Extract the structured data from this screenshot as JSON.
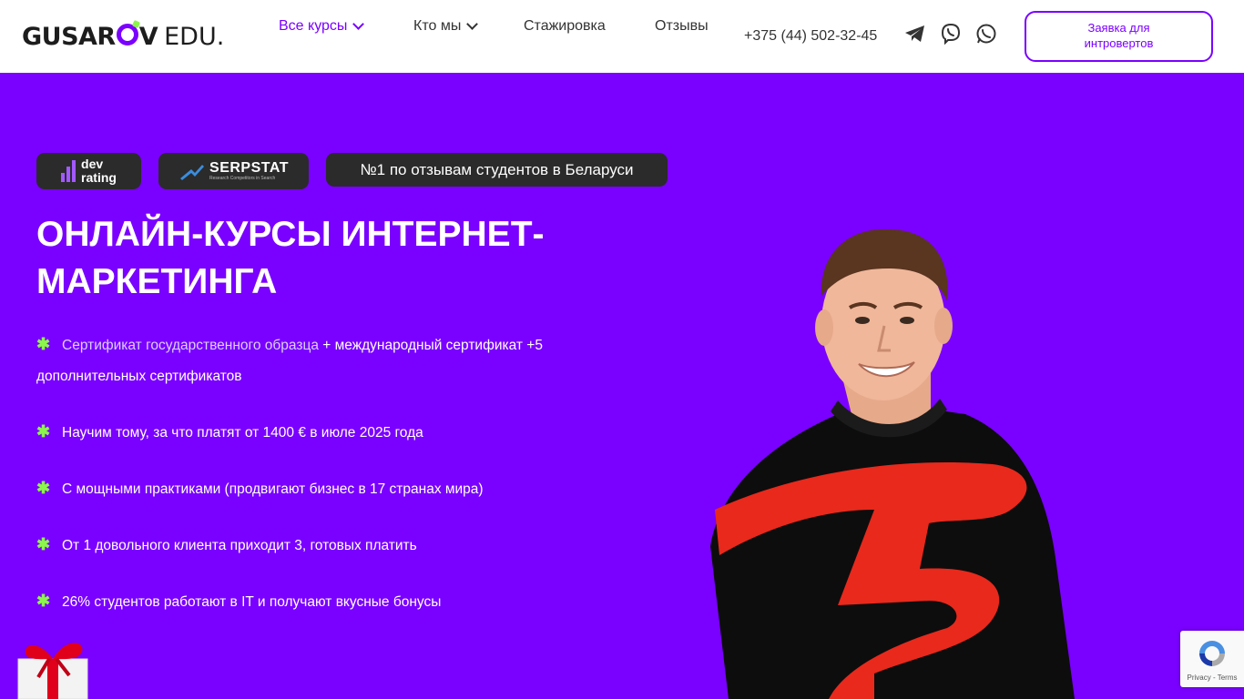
{
  "header": {
    "logo_main": "GUSAR",
    "logo_end": "V",
    "logo_edu": "EDU.",
    "nav": [
      {
        "label": "Все курсы",
        "active": true,
        "dropdown": true
      },
      {
        "label": "Кто мы",
        "active": false,
        "dropdown": true
      },
      {
        "label": "Стажировка",
        "active": false,
        "dropdown": false
      },
      {
        "label": "Отзывы",
        "active": false,
        "dropdown": false
      }
    ],
    "phone": "+375 (44) 502-32-45",
    "social_icons": [
      "telegram-icon",
      "viber-icon",
      "whatsapp-icon"
    ],
    "cta_label": "Заявка для интровертов"
  },
  "badges": {
    "devrating_line1": "dev",
    "devrating_line2": "rating",
    "serpstat_main": "SERPSTAT",
    "serpstat_sub": "Research Competitors in Search",
    "top_label": "№1 по отзывам студентов в Беларуси"
  },
  "hero": {
    "title": "ОНЛАЙН-КУРСЫ ИНТЕРНЕТ-МАРКЕТИНГА",
    "features": [
      {
        "highlight": "Сертификат государственного образца",
        "text": " + международный сертификат +5 дополнительных сертификатов"
      },
      {
        "highlight": "",
        "text": "Научим тому, за что платят от 1400 € в июле 2025 года"
      },
      {
        "highlight": "",
        "text": "С мощными практиками (продвигают бизнес в 17 странах мира)"
      },
      {
        "highlight": "",
        "text": "От 1 довольного клиента приходит 3, готовых платить"
      },
      {
        "highlight": "",
        "text": "26% студентов работают в IT и получают вкусные бонусы"
      }
    ]
  },
  "recaptcha": {
    "links": "Privacy - Terms"
  },
  "colors": {
    "brand_purple": "#7a00ff",
    "accent_green": "#8cf54b",
    "badge_dark": "#2b2b2b"
  }
}
